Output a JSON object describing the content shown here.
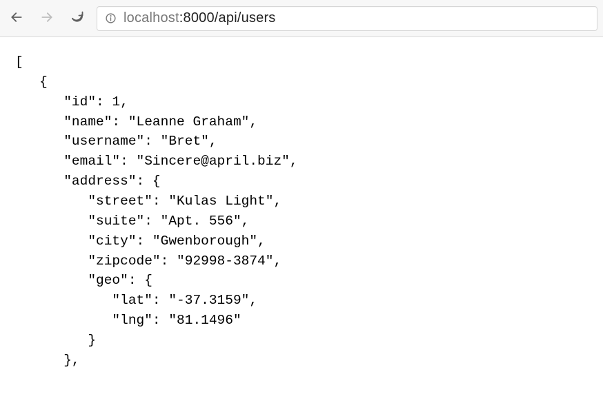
{
  "address_bar": {
    "host": "localhost",
    "path": ":8000/api/users"
  },
  "json_lines": [
    {
      "indent": 0,
      "text": "["
    },
    {
      "indent": 1,
      "text": "{"
    },
    {
      "indent": 2,
      "text": "\"id\": 1,"
    },
    {
      "indent": 2,
      "text": "\"name\": \"Leanne Graham\","
    },
    {
      "indent": 2,
      "text": "\"username\": \"Bret\","
    },
    {
      "indent": 2,
      "text": "\"email\": \"Sincere@april.biz\","
    },
    {
      "indent": 2,
      "text": "\"address\": {"
    },
    {
      "indent": 3,
      "text": "\"street\": \"Kulas Light\","
    },
    {
      "indent": 3,
      "text": "\"suite\": \"Apt. 556\","
    },
    {
      "indent": 3,
      "text": "\"city\": \"Gwenborough\","
    },
    {
      "indent": 3,
      "text": "\"zipcode\": \"92998-3874\","
    },
    {
      "indent": 3,
      "text": "\"geo\": {"
    },
    {
      "indent": 4,
      "text": "\"lat\": \"-37.3159\","
    },
    {
      "indent": 4,
      "text": "\"lng\": \"81.1496\""
    },
    {
      "indent": 3,
      "text": "}"
    },
    {
      "indent": 2,
      "text": "},"
    }
  ]
}
